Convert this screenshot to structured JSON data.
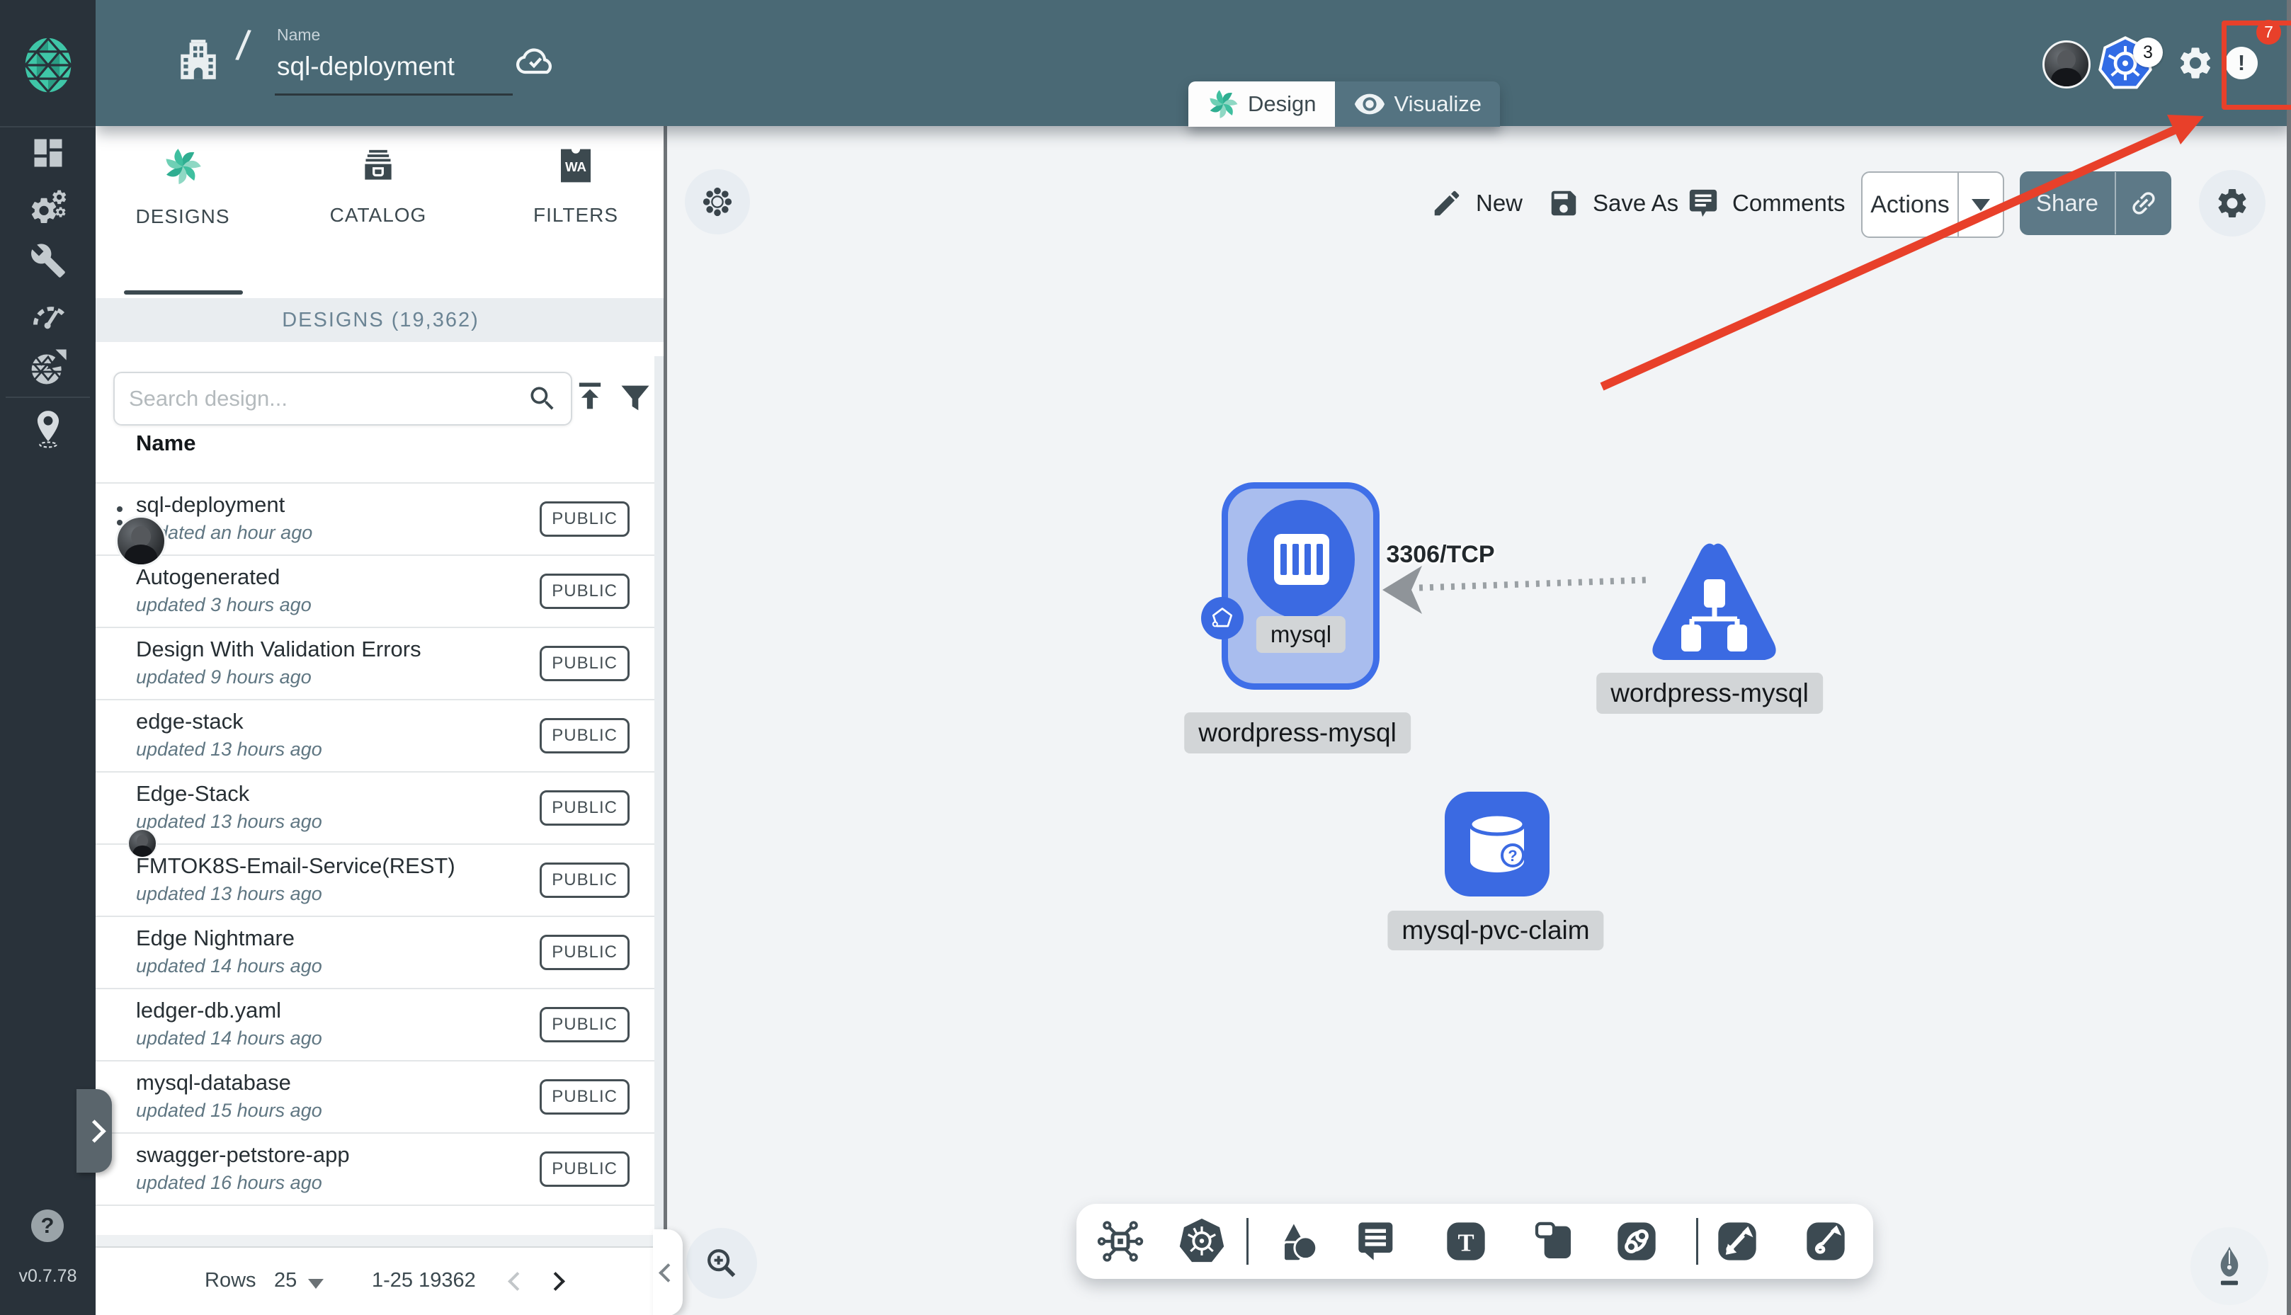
{
  "colors": {
    "header_teal": "#4A6975",
    "sidebar_dark": "#29323A",
    "brand_green": "#3FC6A7",
    "node_blue": "#3B6AE2",
    "annotation_red": "#E8402A"
  },
  "topbar": {
    "name_label": "Name",
    "name_value": "sql-deployment",
    "breadcrumb_separator": "/",
    "kubernetes_badge": "3",
    "notification_badge": "7",
    "notification_glyph": "!"
  },
  "view_tabs": {
    "design": "Design",
    "visualize": "Visualize"
  },
  "sidebar": {
    "version": "v0.7.78",
    "help_glyph": "?"
  },
  "panel": {
    "tabs": {
      "designs": "DESIGNS",
      "catalog": "CATALOG",
      "filters": "FILTERS"
    },
    "filters_icon_text": "WA",
    "count_header": "DESIGNS (19,362)",
    "search_placeholder": "Search design...",
    "name_column": "Name",
    "rows": [
      {
        "name": "sql-deployment",
        "updated": "updated an hour ago",
        "visibility": "PUBLIC"
      },
      {
        "name": "Autogenerated",
        "updated": "updated 3 hours ago",
        "visibility": "PUBLIC"
      },
      {
        "name": "Design With Validation Errors",
        "updated": "updated 9 hours ago",
        "visibility": "PUBLIC"
      },
      {
        "name": "edge-stack",
        "updated": "updated 13 hours ago",
        "visibility": "PUBLIC"
      },
      {
        "name": "Edge-Stack",
        "updated": "updated 13 hours ago",
        "visibility": "PUBLIC"
      },
      {
        "name": "FMTOK8S-Email-Service(REST)",
        "updated": "updated 13 hours ago",
        "visibility": "PUBLIC"
      },
      {
        "name": "Edge Nightmare",
        "updated": "updated 14 hours ago",
        "visibility": "PUBLIC"
      },
      {
        "name": "ledger-db.yaml",
        "updated": "updated 14 hours ago",
        "visibility": "PUBLIC"
      },
      {
        "name": "mysql-database",
        "updated": "updated 15 hours ago",
        "visibility": "PUBLIC"
      },
      {
        "name": "swagger-petstore-app",
        "updated": "updated 16 hours ago",
        "visibility": "PUBLIC"
      }
    ],
    "pagination": {
      "rows_label": "Rows",
      "per_page": "25",
      "range": "1-25 19362"
    }
  },
  "canvas": {
    "toolbar": {
      "new": "New",
      "save_as": "Save As",
      "comments": "Comments",
      "actions": "Actions",
      "share": "Share"
    },
    "nodes": {
      "deployment_container_label": "mysql",
      "deployment_label": "wordpress-mysql",
      "service_label": "wordpress-mysql",
      "pvc_label": "mysql-pvc-claim"
    },
    "edge_label": "3306/TCP",
    "tools_text_glyph": "T"
  }
}
